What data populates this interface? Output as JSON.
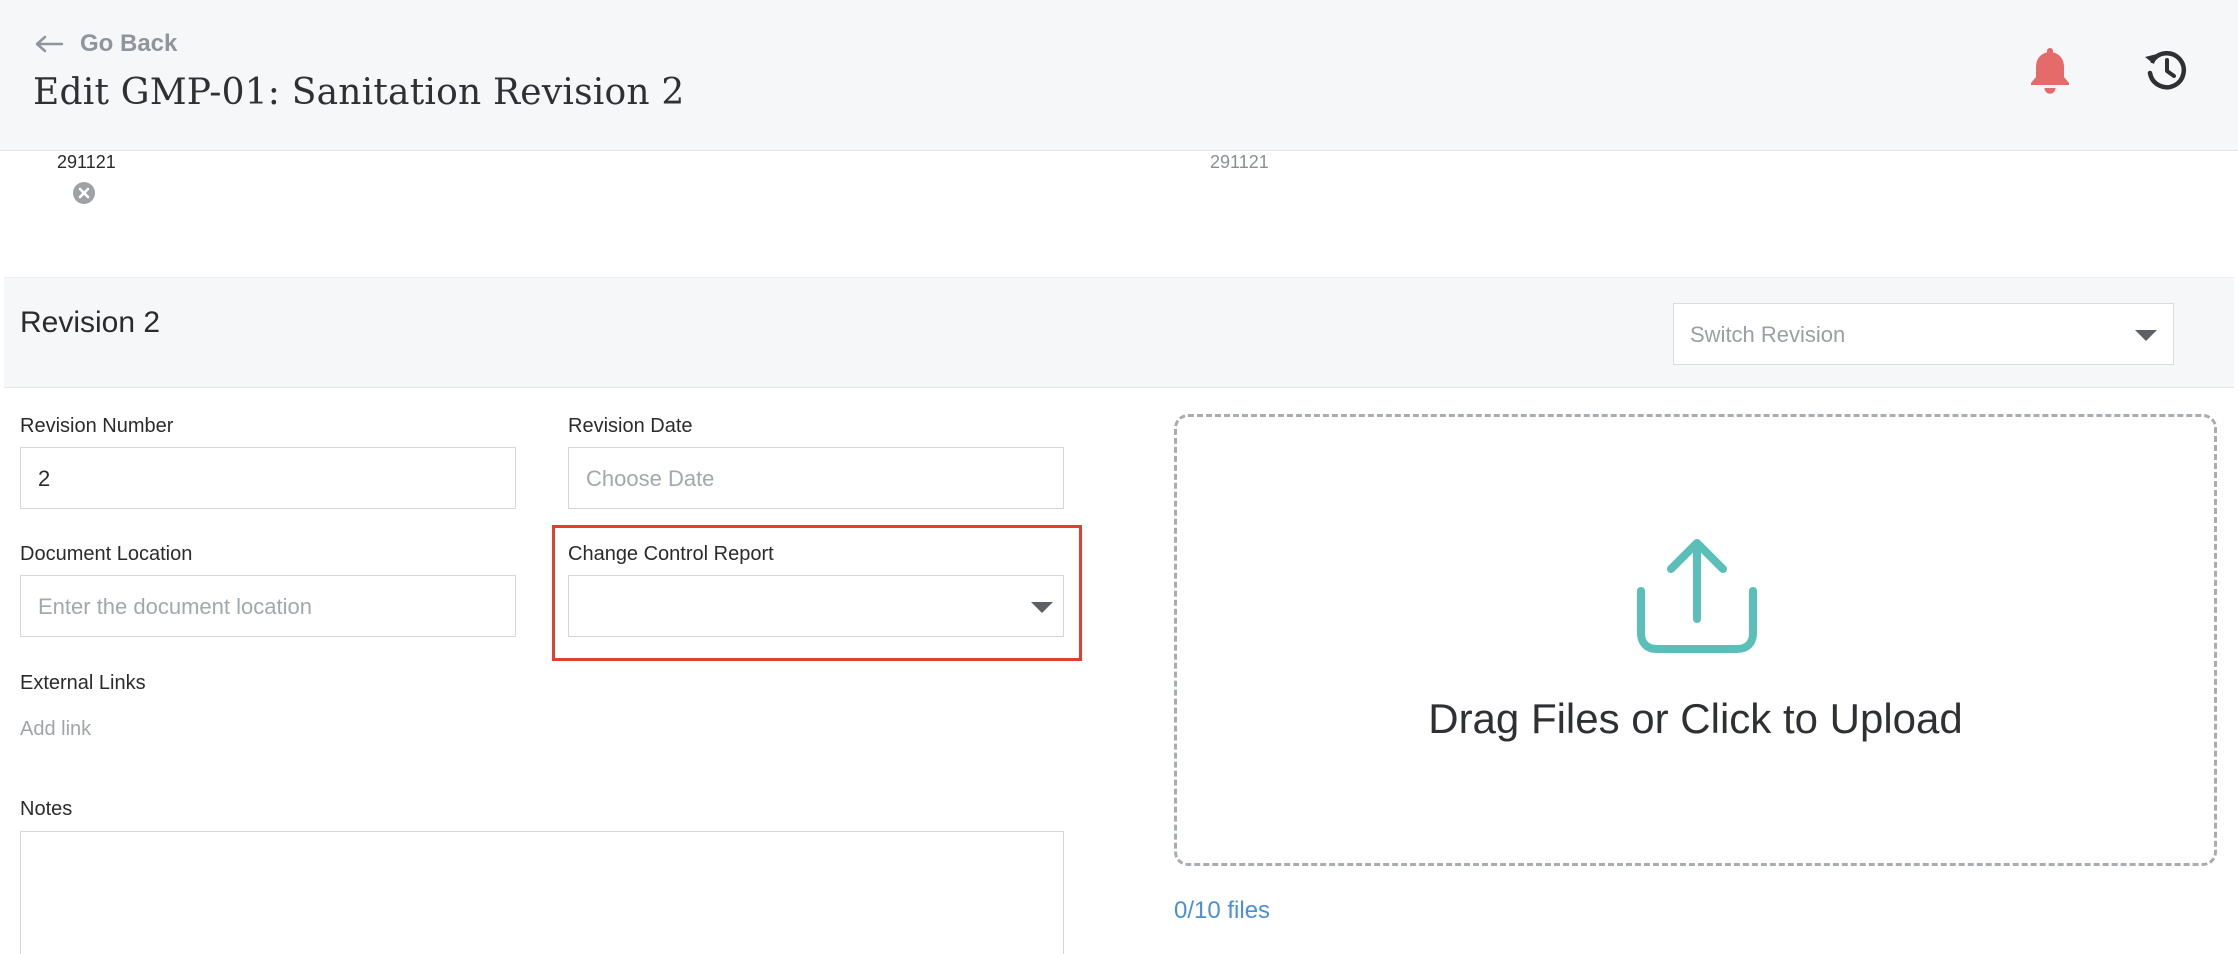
{
  "header": {
    "back_label": "Go Back",
    "title": "Edit GMP-01: Sanitation Revision 2",
    "icons": [
      "arrow-left-icon",
      "bell-icon",
      "history-icon"
    ],
    "bell_color": "#e56b6b"
  },
  "strip": {
    "left_value": "291121",
    "right_value": "291121"
  },
  "revision": {
    "title": "Revision 2",
    "switch_placeholder": "Switch Revision"
  },
  "form": {
    "revision_number_label": "Revision Number",
    "revision_number_value": "2",
    "revision_date_label": "Revision Date",
    "revision_date_placeholder": "Choose Date",
    "document_location_label": "Document Location",
    "document_location_placeholder": "Enter the document location",
    "change_control_label": "Change Control Report",
    "change_control_value": "",
    "external_links_label": "External Links",
    "add_link_label": "Add link",
    "notes_label": "Notes"
  },
  "upload": {
    "text": "Drag Files or Click to Upload",
    "files_count": "0/10 files",
    "accent_color": "#5bbfb9"
  },
  "colors": {
    "highlight": "#e04030",
    "link": "#4a90d9"
  }
}
